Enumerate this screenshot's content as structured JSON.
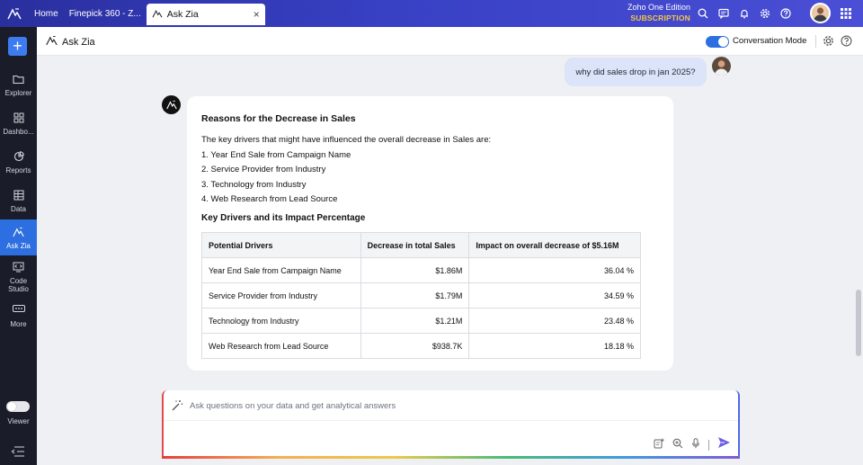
{
  "topbar": {
    "tabs": [
      {
        "label": "Home"
      },
      {
        "label": "Finepick 360 - Z..."
      }
    ],
    "active_tab": {
      "label": "Ask Zia",
      "close": "×"
    },
    "edition": {
      "name": "Zoho One Edition",
      "plan": "SUBSCRIPTION"
    },
    "icons": [
      "search-icon",
      "chat-icon",
      "bell-icon",
      "gear-icon",
      "help-icon",
      "avatar",
      "apps-grid-icon"
    ]
  },
  "sidebar": {
    "new_button": "+",
    "items": [
      {
        "label": "Explorer",
        "icon": "folder-icon"
      },
      {
        "label": "Dashbo...",
        "icon": "dashboard-icon"
      },
      {
        "label": "Reports",
        "icon": "reports-icon"
      },
      {
        "label": "Data",
        "icon": "table-icon"
      },
      {
        "label": "Ask Zia",
        "icon": "zia-icon",
        "active": true
      },
      {
        "label": "Code Studio",
        "icon": "code-icon"
      },
      {
        "label": "More",
        "icon": "more-icon"
      }
    ],
    "viewer_label": "Viewer"
  },
  "header": {
    "title": "Ask Zia",
    "conversation_mode_label": "Conversation Mode",
    "conversation_mode_on": true
  },
  "chat": {
    "user_question": "why did sales drop in jan 2025?",
    "answer": {
      "title": "Reasons for the Decrease in Sales",
      "intro": "The key drivers that might have influenced the overall decrease in Sales are:",
      "list": [
        "1. Year End Sale from Campaign Name",
        "2. Service Provider from Industry",
        "3. Technology from Industry",
        "4. Web Research from Lead Source"
      ],
      "table_title": "Key Drivers and its Impact Percentage",
      "table": {
        "headers": [
          "Potential Drivers",
          "Decrease in total Sales",
          "Impact on overall decrease of $5.16M"
        ],
        "rows": [
          [
            "Year End Sale from Campaign Name",
            "$1.86M",
            "36.04 %"
          ],
          [
            "Service Provider from Industry",
            "$1.79M",
            "34.59 %"
          ],
          [
            "Technology from Industry",
            "$1.21M",
            "23.48 %"
          ],
          [
            "Web Research from Lead Source",
            "$938.7K",
            "18.18 %"
          ]
        ]
      }
    }
  },
  "ask_input": {
    "placeholder": "Ask questions on your data and get analytical answers"
  },
  "colors": {
    "topbar": "#3840c4",
    "sidebar": "#1a1d29",
    "accent": "#2d6fe0",
    "user_bubble": "#dbe4f8"
  }
}
